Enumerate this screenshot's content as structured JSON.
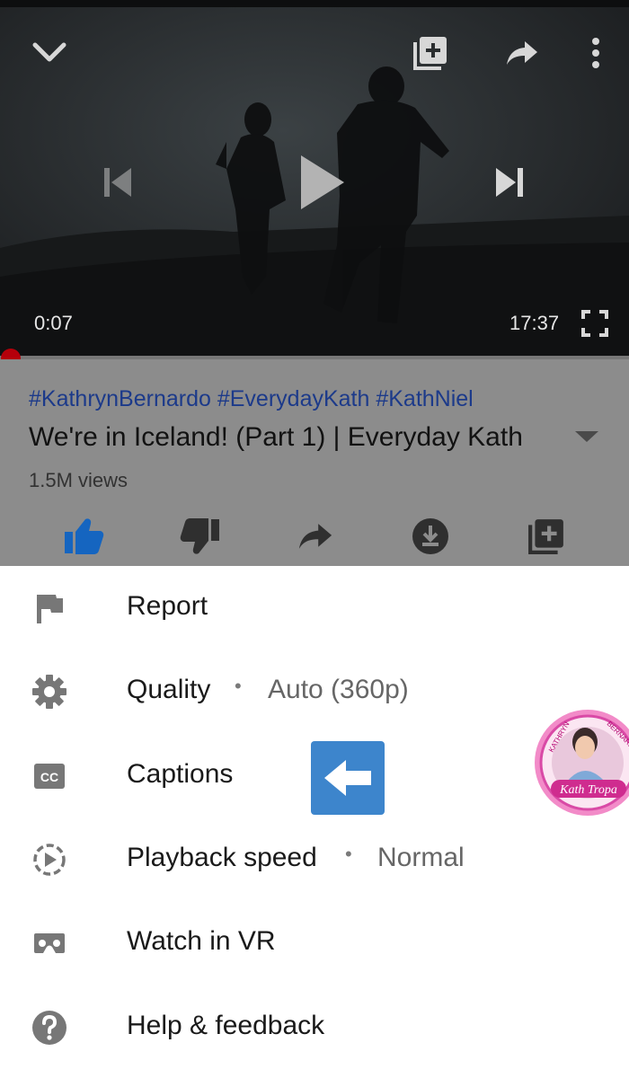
{
  "player": {
    "current_time": "0:07",
    "duration": "17:37",
    "progress": 0.0066
  },
  "video": {
    "hashtags": "#KathrynBernardo #EverydayKath #KathNiel",
    "title": "We're in Iceland! (Part 1) | Everyday Kath",
    "views": "1.5M views"
  },
  "menu": {
    "items": [
      {
        "label": "Report",
        "icon": "flag-icon"
      },
      {
        "label": "Quality",
        "value": "Auto (360p)",
        "separator": "•",
        "icon": "gear-icon"
      },
      {
        "label": "Captions",
        "icon": "cc-icon"
      },
      {
        "label": "Playback speed",
        "value": "Normal",
        "separator": "•",
        "icon": "playback-speed-icon"
      },
      {
        "label": "Watch in VR",
        "icon": "vr-headset-icon"
      },
      {
        "label": "Help & feedback",
        "icon": "help-icon"
      }
    ]
  },
  "colors": {
    "like_active": "#1565c0",
    "progress_red": "#b5000b",
    "arrow_badge": "#3d85cc"
  }
}
